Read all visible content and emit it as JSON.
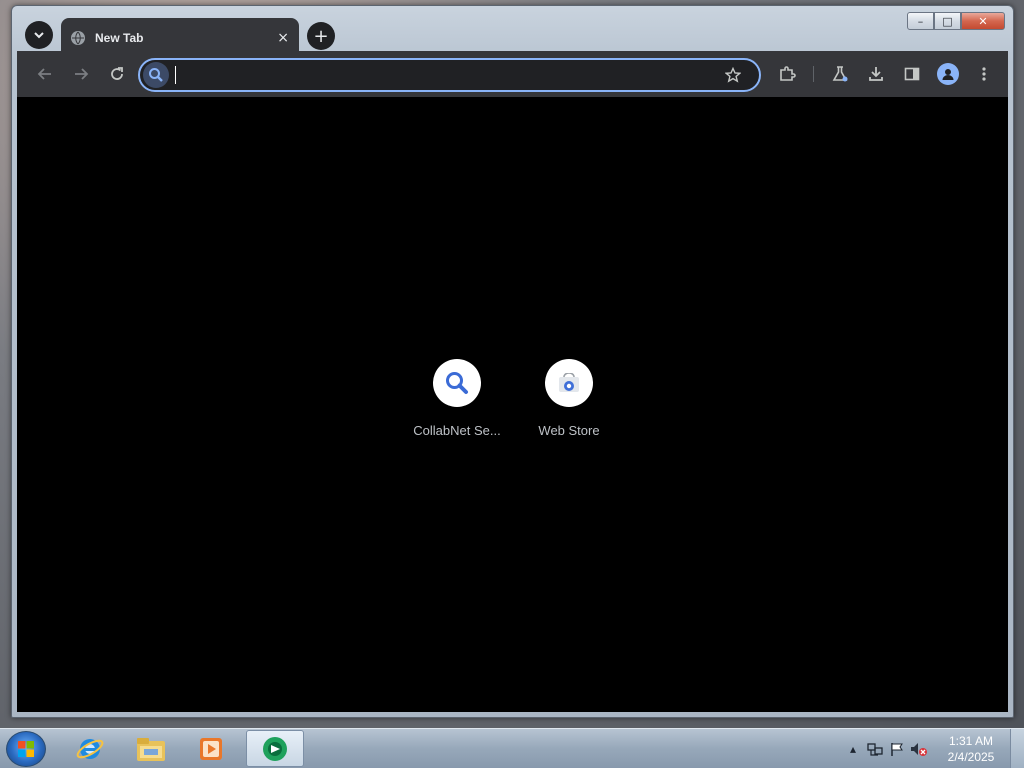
{
  "window": {
    "controls": {
      "minimize": "–",
      "maximize": "□",
      "close": "✕"
    }
  },
  "tabs": [
    {
      "title": "New Tab",
      "icon": "globe-icon",
      "close": "×"
    }
  ],
  "tab_search": {
    "icon": "chevron-down-icon",
    "glyph": "⌄"
  },
  "new_tab": {
    "glyph": "+"
  },
  "toolbar": {
    "back": "←",
    "forward": "→",
    "reload": "↻",
    "omnibox_value": "",
    "star": "☆",
    "extensions_icon": "puzzle-icon",
    "labs_icon": "flask-icon",
    "download_icon": "download-icon",
    "sidepanel_icon": "side-panel-icon",
    "profile_icon": "person-icon",
    "menu": "⋮"
  },
  "shortcuts": [
    {
      "label": "CollabNet Se...",
      "icon": "magnifier-icon"
    },
    {
      "label": "Web Store",
      "icon": "webstore-icon"
    }
  ],
  "taskbar": {
    "apps": [
      "internet-explorer-icon",
      "file-explorer-icon",
      "media-player-icon",
      "chrome-icon"
    ],
    "active_app": "chrome-icon"
  },
  "tray": {
    "overflow": "▴",
    "time": "1:31 AM",
    "date": "2/4/2025"
  },
  "colors": {
    "accent": "#8ab4f8",
    "toolbar_bg": "#35363a",
    "content_bg": "#000000"
  }
}
